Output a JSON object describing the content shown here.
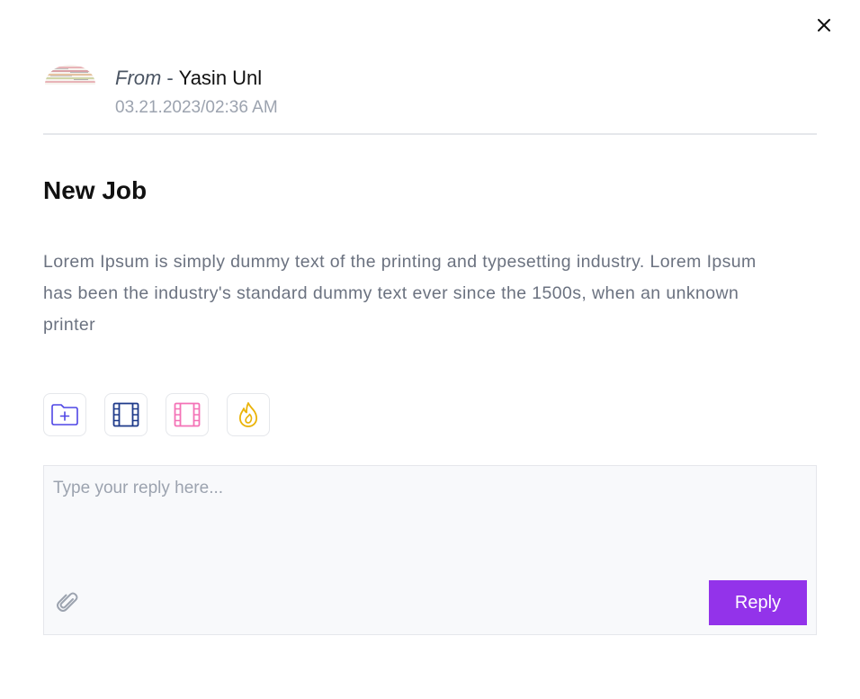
{
  "header": {
    "from_label": "From",
    "separator": "-",
    "sender_name": "Yasin Unl",
    "timestamp": "03.21.2023/02:36 AM"
  },
  "message": {
    "title": "New Job",
    "body": "Lorem Ipsum is simply dummy text of the printing and typesetting industry. Lorem Ipsum has been the industry's standard dummy text ever since the 1500s, when an unknown printer"
  },
  "attachments": [
    {
      "icon": "folder-add-icon",
      "color": "#4f46e5"
    },
    {
      "icon": "film-icon",
      "color": "#1e3a8a"
    },
    {
      "icon": "film-icon",
      "color": "#f472b6"
    },
    {
      "icon": "fire-icon",
      "color": "#eab308"
    }
  ],
  "reply": {
    "placeholder": "Type your reply here...",
    "button_label": "Reply"
  },
  "colors": {
    "accent": "#9333ea",
    "muted_text": "#6b7280",
    "placeholder": "#9ca3af",
    "border": "#e5e7eb",
    "input_bg": "#f8f9fb"
  }
}
